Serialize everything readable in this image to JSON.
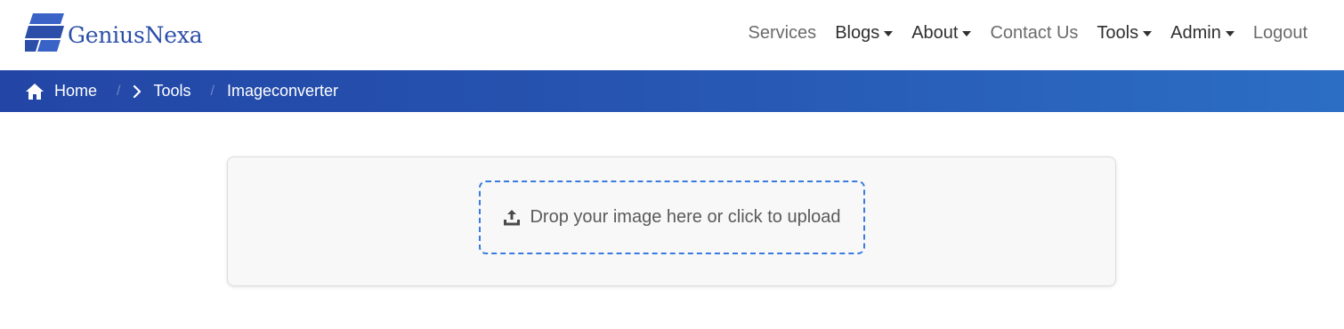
{
  "brand": {
    "name": "GeniusNexa",
    "colors": {
      "logo": "#2b4ea8",
      "logo_light": "#3a63c8"
    }
  },
  "nav": {
    "items": [
      {
        "label": "Services",
        "dropdown": false
      },
      {
        "label": "Blogs",
        "dropdown": true
      },
      {
        "label": "About",
        "dropdown": true
      },
      {
        "label": "Contact Us",
        "dropdown": false
      },
      {
        "label": "Tools",
        "dropdown": true
      },
      {
        "label": "Admin",
        "dropdown": true
      },
      {
        "label": "Logout",
        "dropdown": false
      }
    ]
  },
  "breadcrumb": {
    "home": "Home",
    "tools": "Tools",
    "current": "Imageconverter",
    "separator": "/",
    "icons": [
      "home-icon",
      "chevron-right-icon"
    ],
    "colors": {
      "bar_start": "#2346a6",
      "bar_end": "#2c6ec4"
    }
  },
  "upload": {
    "label": "Drop your image here or click to upload",
    "icon": "upload-icon",
    "colors": {
      "dashed_border": "#3a7ae0",
      "card_bg": "#f8f8f8"
    }
  }
}
